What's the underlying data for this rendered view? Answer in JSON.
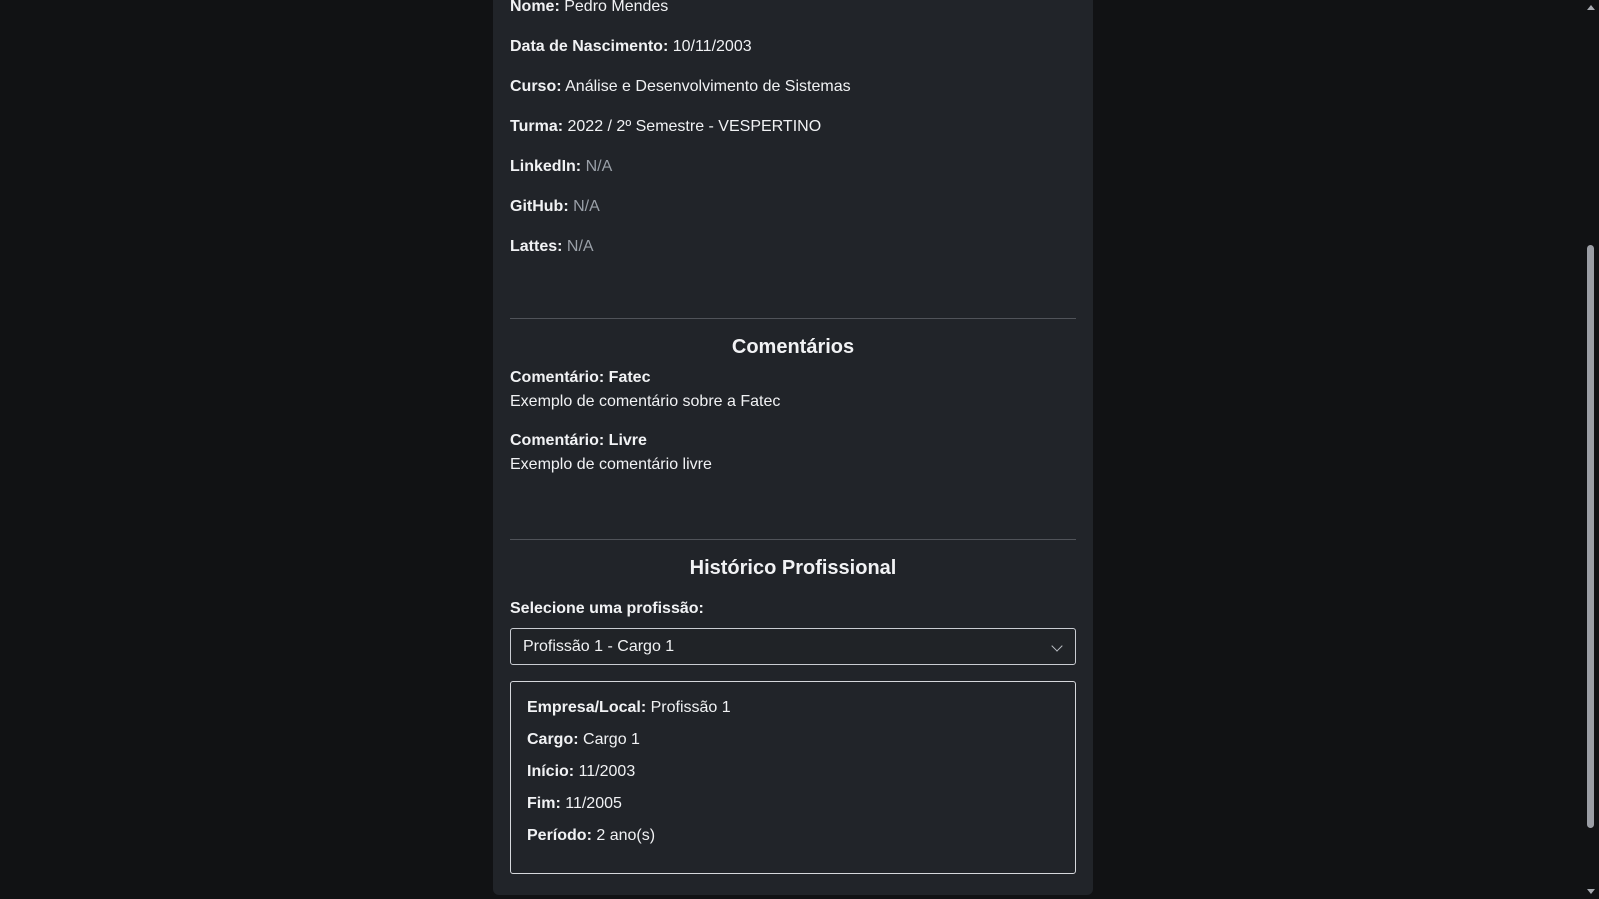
{
  "profile": {
    "fields": [
      {
        "label": "Nome:",
        "value": "Pedro Mendes"
      },
      {
        "label": "Data de Nascimento:",
        "value": "10/11/2003"
      },
      {
        "label": "Curso:",
        "value": "Análise e Desenvolvimento de Sistemas"
      },
      {
        "label": "Turma:",
        "value": "2022 / 2º Semestre - VESPERTINO"
      },
      {
        "label": "LinkedIn:",
        "value": "N/A"
      },
      {
        "label": "GitHub:",
        "value": "N/A"
      },
      {
        "label": "Lattes:",
        "value": "N/A"
      }
    ]
  },
  "comments": {
    "title": "Comentários",
    "items": [
      {
        "title": "Comentário: Fatec",
        "text": "Exemplo de comentário sobre a Fatec"
      },
      {
        "title": "Comentário: Livre",
        "text": "Exemplo de comentário livre"
      }
    ]
  },
  "history": {
    "title": "Histórico Profissional",
    "select_label": "Selecione uma profissão:",
    "selected": "Profissão 1 - Cargo 1",
    "details": [
      {
        "label": "Empresa/Local:",
        "value": "Profissão 1"
      },
      {
        "label": "Cargo:",
        "value": "Cargo 1"
      },
      {
        "label": "Início:",
        "value": "11/2003"
      },
      {
        "label": "Fim:",
        "value": "11/2005"
      },
      {
        "label": "Período:",
        "value": "2 ano(s)"
      }
    ]
  },
  "icons": {
    "select_arrow": "chevron-down-icon",
    "scroll_up": "arrow-up-icon",
    "scroll_down": "arrow-down-icon"
  },
  "colors": {
    "page_background": "#111214",
    "card_background": "#212429",
    "na_text": "#9aa0a8"
  }
}
